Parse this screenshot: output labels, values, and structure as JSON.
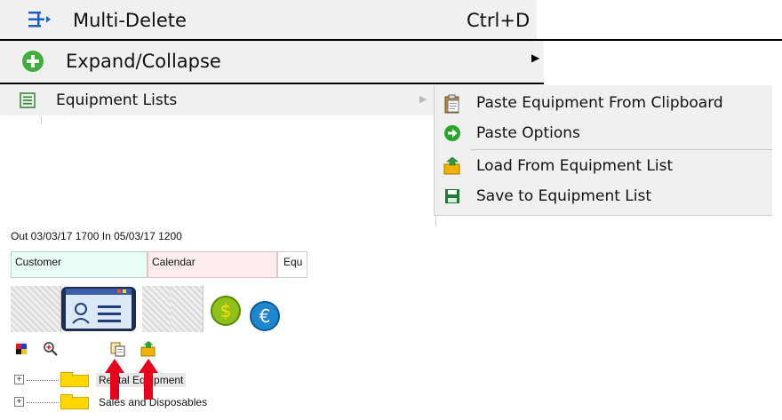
{
  "menu": {
    "multi_delete": {
      "label": "Multi-Delete",
      "shortcut": "Ctrl+D",
      "icon": "multi-delete-icon"
    },
    "expand_collapse": {
      "label": "Expand/Collapse",
      "icon": "green-plus-icon"
    },
    "equipment_lists": {
      "label": "Equipment Lists",
      "icon": "list-icon"
    }
  },
  "submenu": {
    "items": [
      {
        "label": "Paste Equipment From Clipboard",
        "icon": "clipboard-paste-icon"
      },
      {
        "label": "Paste Options",
        "icon": "green-arrow-circle-icon"
      },
      {
        "label": "Load From Equipment List",
        "icon": "load-folder-icon"
      },
      {
        "label": "Save to Equipment List",
        "icon": "save-disk-icon"
      }
    ]
  },
  "app": {
    "status_line": "Out 03/03/17 1700  In 05/03/17 1200",
    "tabs": [
      {
        "label": "Customer",
        "color": "#eafdf7"
      },
      {
        "label": "Calendar",
        "color": "#ffecef"
      },
      {
        "label": "Equ",
        "color": "#ffffff"
      }
    ],
    "toolbar_icons": [
      "color-palette-icon",
      "zoom-icon",
      "paste-icon",
      "load-list-icon"
    ],
    "tree": [
      {
        "label": "Rental Equipment",
        "icon": "folder-icon"
      },
      {
        "label": "Sales and Disposables",
        "icon": "folder-icon"
      }
    ]
  },
  "colors": {
    "menu_bg": "#f0f0f0",
    "highlight_arrow": "#e8001c",
    "folder": "#ffd700"
  }
}
